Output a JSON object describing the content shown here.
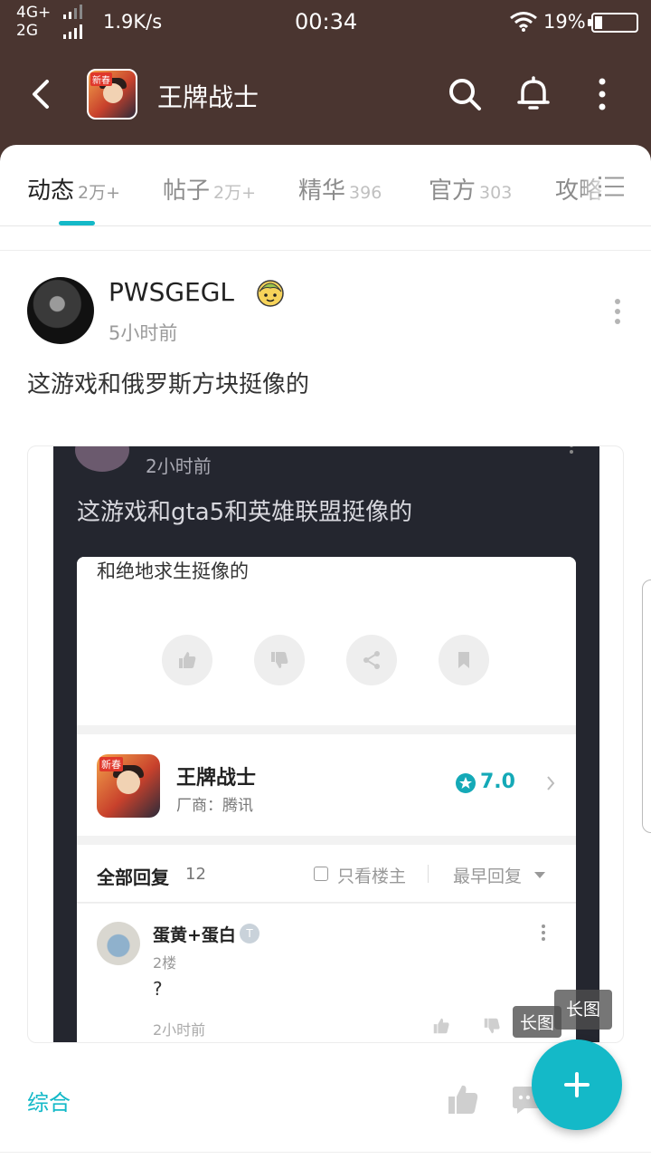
{
  "status_bar": {
    "network_4g": "4G+",
    "network_2g": "2G",
    "speed": "1.9K/s",
    "time": "00:34",
    "battery": "19%"
  },
  "header": {
    "title": "王牌战士",
    "app_icon_tag": "新春",
    "icons": [
      "back-icon",
      "search-icon",
      "bell-icon",
      "more-vertical-icon"
    ]
  },
  "tabs": [
    {
      "label": "动态",
      "count": "2万+",
      "active": true
    },
    {
      "label": "帖子",
      "count": "2万+"
    },
    {
      "label": "精华",
      "count": "396"
    },
    {
      "label": "官方",
      "count": "303"
    },
    {
      "label": "攻略",
      "count": ""
    }
  ],
  "post": {
    "author": "PWSGEGL",
    "time": "5小时前",
    "text": "这游戏和俄罗斯方块挺像的",
    "category": "综合",
    "image_badge": "长图"
  },
  "embedded": {
    "time": "2小时前",
    "text": "这游戏和gta5和英雄联盟挺像的",
    "card_text": "和绝地求生挺像的",
    "app_name": "王牌战士",
    "app_tag": "新春",
    "vendor": "厂商：腾讯",
    "rating": "7.0",
    "replies_title": "全部回复",
    "replies_count": "12",
    "only_author": "只看楼主",
    "sort": "最早回复",
    "reply": {
      "name": "蛋黄+蛋白",
      "badge": "T",
      "floor": "2楼",
      "text": "?",
      "time": "2小时前"
    },
    "inner_badge": "长图"
  },
  "colors": {
    "header_bg": "#4a3530",
    "accent": "#14b9c8",
    "embedded_bg": "#24262f"
  }
}
